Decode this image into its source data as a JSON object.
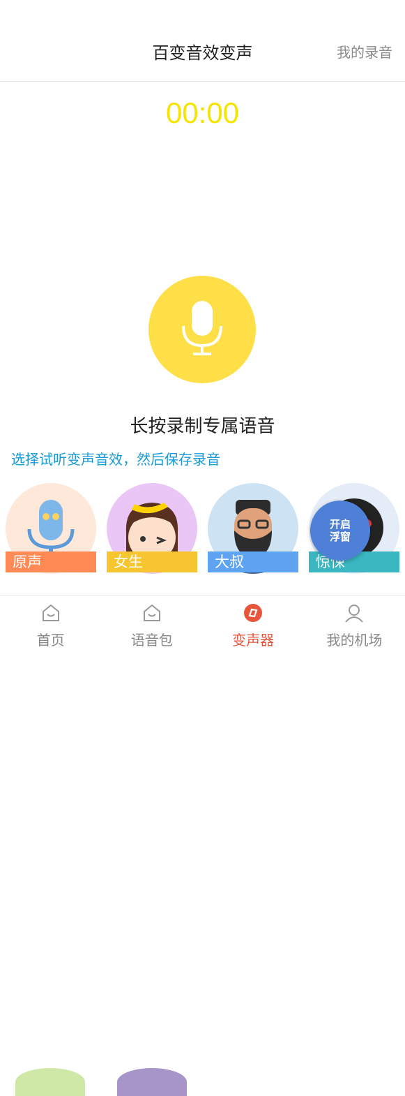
{
  "header": {
    "title": "百变音效变声",
    "records_link": "我的录音"
  },
  "timer": "00:00",
  "record": {
    "hint": "长按录制专属语音",
    "sub_hint": "选择试听变声音效，然后保存录音"
  },
  "effects": [
    {
      "label": "原声",
      "label_color": "#ff8a55"
    },
    {
      "label": "女生",
      "label_color": "#f7c52f"
    },
    {
      "label": "大叔",
      "label_color": "#5ea4f2"
    },
    {
      "label": "惊悚",
      "label_color": "#3ab7c0"
    }
  ],
  "float_button": {
    "line1": "开启",
    "line2": "浮窗"
  },
  "tabbar": {
    "items": [
      {
        "label": "首页",
        "icon": "home-icon",
        "active": false
      },
      {
        "label": "语音包",
        "icon": "voice-pack-icon",
        "active": false
      },
      {
        "label": "变声器",
        "icon": "voice-changer-icon",
        "active": true
      },
      {
        "label": "我的机场",
        "icon": "profile-icon",
        "active": false
      }
    ]
  },
  "colors": {
    "accent": "#e8553c",
    "timer": "#f5e400",
    "mic": "#ffdf47",
    "link": "#1a9ad6"
  }
}
